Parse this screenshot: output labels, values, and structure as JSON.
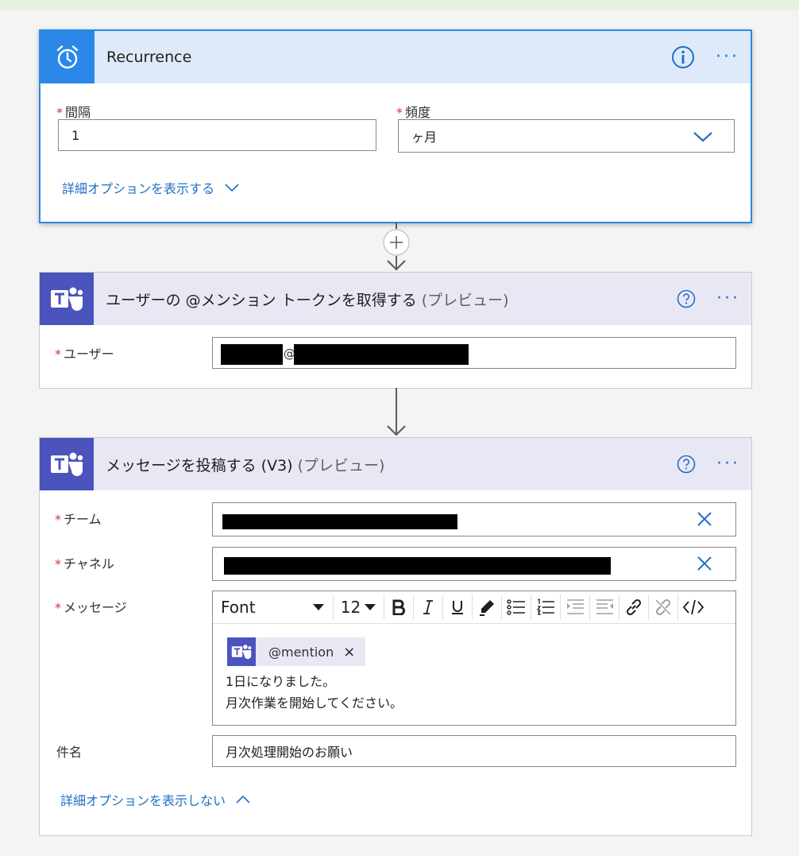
{
  "colors": {
    "accent": "#1f6fc5",
    "recurrence_icon_bg": "#2b88e9",
    "teams_icon_bg": "#4b53bc",
    "required": "#d13438"
  },
  "recurrence": {
    "title": "Recurrence",
    "interval_label": "間隔",
    "interval_value": "1",
    "frequency_label": "頻度",
    "frequency_value": "ヶ月",
    "advanced_link": "詳細オプションを表示する"
  },
  "mention_token": {
    "title": "ユーザーの @メンション トークンを取得する",
    "preview": "(プレビュー)",
    "user_label": "ユーザー",
    "user_at": "@"
  },
  "post_message": {
    "title": "メッセージを投稿する (V3)",
    "preview": "(プレビュー)",
    "team_label": "チーム",
    "channel_label": "チャネル",
    "message_label": "メッセージ",
    "toolbar": {
      "font": "Font",
      "size": "12"
    },
    "mention_chip": "@mention",
    "mention_remove": "×",
    "message_line1": "1日になりました。",
    "message_line2": "月次作業を開始してください。",
    "subject_label": "件名",
    "subject_value": "月次処理開始のお願い",
    "hide_advanced_link": "詳細オプションを表示しない"
  }
}
